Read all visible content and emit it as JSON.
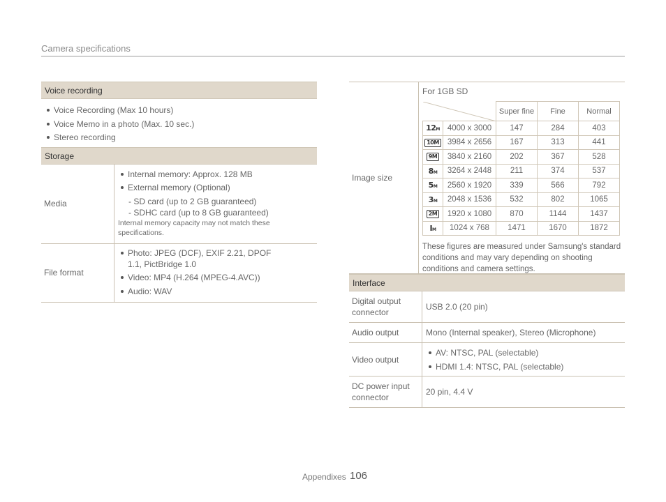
{
  "header": {
    "title": "Camera specifications"
  },
  "left": {
    "voice_recording": {
      "heading": "Voice recording",
      "items": [
        "Voice Recording (Max 10 hours)",
        "Voice Memo in a photo (Max. 10 sec.)",
        "Stereo recording"
      ]
    },
    "storage": {
      "heading": "Storage",
      "media": {
        "label": "Media",
        "items": [
          "Internal memory: Approx. 128 MB",
          "External memory (Optional)"
        ],
        "subitems": [
          "-  SD card (up to 2 GB guaranteed)",
          "-  SDHC card (up to 8 GB guaranteed)"
        ],
        "note": "Internal memory capacity may not match these specifications."
      },
      "file_format": {
        "label": "File format",
        "items": [
          "Photo: JPEG (DCF), EXIF 2.21, DPOF 1.1, PictBridge 1.0",
          "Video: MP4 (H.264 (MPEG-4.AVC))",
          "Audio: WAV"
        ]
      }
    }
  },
  "right": {
    "image_size": {
      "label": "Image size",
      "caption": "For 1GB SD",
      "columns": [
        "Super fine",
        "Fine",
        "Normal"
      ],
      "rows": [
        {
          "icon": "12M",
          "size": "4000 x 3000",
          "super_fine": "147",
          "fine": "284",
          "normal": "403"
        },
        {
          "icon": "10M",
          "size": "3984 x 2656",
          "super_fine": "167",
          "fine": "313",
          "normal": "441"
        },
        {
          "icon": "9M",
          "size": "3840 x 2160",
          "super_fine": "202",
          "fine": "367",
          "normal": "528"
        },
        {
          "icon": "8M",
          "size": "3264 x 2448",
          "super_fine": "211",
          "fine": "374",
          "normal": "537"
        },
        {
          "icon": "5M",
          "size": "2560 x 1920",
          "super_fine": "339",
          "fine": "566",
          "normal": "792"
        },
        {
          "icon": "3M",
          "size": "2048 x 1536",
          "super_fine": "532",
          "fine": "802",
          "normal": "1065"
        },
        {
          "icon": "2M",
          "size": "1920 x 1080",
          "super_fine": "870",
          "fine": "1144",
          "normal": "1437"
        },
        {
          "icon": "1M",
          "size": "1024 x 768",
          "super_fine": "1471",
          "fine": "1670",
          "normal": "1872"
        }
      ],
      "note": "These figures are measured under Samsung's standard conditions and may vary depending on shooting conditions and camera settings."
    },
    "interface": {
      "heading": "Interface",
      "digital_output": {
        "label": "Digital output connector",
        "value": "USB 2.0 (20 pin)"
      },
      "audio_output": {
        "label": "Audio output",
        "value": "Mono (Internal speaker), Stereo (Microphone)"
      },
      "video_output": {
        "label": "Video output",
        "items": [
          "AV: NTSC, PAL (selectable)",
          "HDMI 1.4: NTSC, PAL (selectable)"
        ]
      },
      "dc_power": {
        "label": "DC power input connector",
        "value": "20 pin, 4.4 V"
      }
    }
  },
  "footer": {
    "section": "Appendixes",
    "page": "106"
  }
}
